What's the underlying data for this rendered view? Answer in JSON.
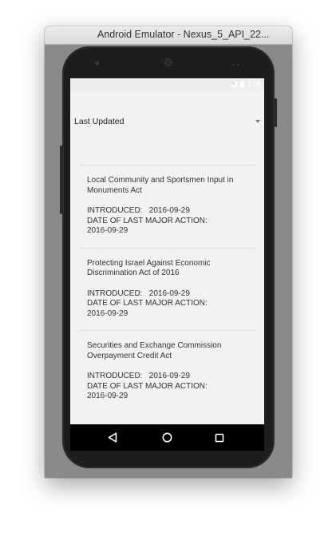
{
  "window": {
    "title": "Android Emulator - Nexus_5_API_22..."
  },
  "statusbar": {
    "time": "3:18"
  },
  "spinner": {
    "selected": "Last Updated"
  },
  "bills": [
    {
      "title": "Local Community and Sportsmen Input in Monuments Act",
      "introduced": "INTRODUCED:   2016-09-29",
      "last_action_label": "DATE OF LAST MAJOR ACTION:",
      "last_action_date": "2016-09-29"
    },
    {
      "title": "Protecting Israel Against Economic Discrimination Act of 2016",
      "introduced": "INTRODUCED:   2016-09-29",
      "last_action_label": "DATE OF LAST MAJOR ACTION:",
      "last_action_date": "2016-09-29"
    },
    {
      "title": "Securities and Exchange Commission Overpayment Credit Act",
      "introduced": "INTRODUCED:   2016-09-29",
      "last_action_label": "DATE OF LAST MAJOR ACTION:",
      "last_action_date": "2016-09-29"
    }
  ],
  "navbar": {
    "back_icon": "back-triangle-icon",
    "home_icon": "home-circle-icon",
    "recents_icon": "recents-square-icon"
  }
}
